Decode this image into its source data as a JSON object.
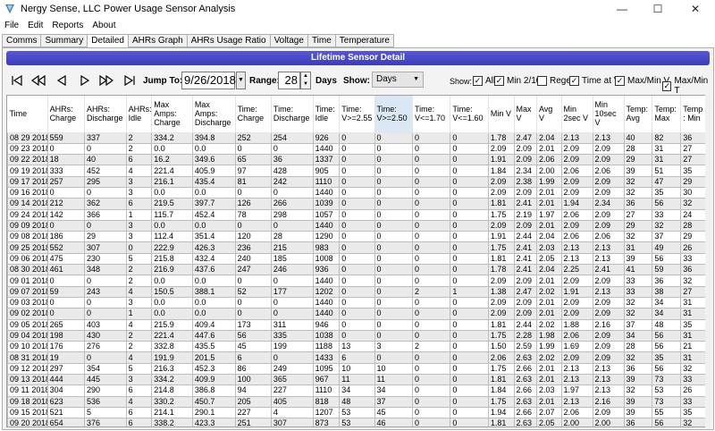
{
  "window": {
    "title": "Nergy Sense, LLC Power Usage Sensor Analysis",
    "minimize": "—",
    "maximize": "☐",
    "close": "✕"
  },
  "menu": [
    "File",
    "Edit",
    "Reports",
    "About"
  ],
  "tabs": [
    {
      "label": "Comms",
      "active": false
    },
    {
      "label": "Summary",
      "active": false
    },
    {
      "label": "Detailed",
      "active": true
    },
    {
      "label": "AHRs Graph",
      "active": false
    },
    {
      "label": "AHRs Usage Ratio",
      "active": false
    },
    {
      "label": "Voltage",
      "active": false
    },
    {
      "label": "Time",
      "active": false
    },
    {
      "label": "Temperature",
      "active": false
    }
  ],
  "banner": "Lifetime Sensor Detail",
  "toolbar": {
    "jump_label": "Jump To:",
    "date_value": "9/26/2018",
    "range_label": "Range:",
    "range_value": "28",
    "days_label": "Days",
    "show_label": "Show:",
    "show_value": "Days",
    "show_checks_label": "Show:",
    "checks": [
      {
        "label": "All",
        "checked": true
      },
      {
        "label": "Min 2/10",
        "checked": true
      },
      {
        "label": "Regen",
        "checked": false
      },
      {
        "label": "Time at V",
        "checked": true
      },
      {
        "label": "Max/Min V",
        "checked": true
      },
      {
        "label": "Max/Min T",
        "checked": true
      }
    ]
  },
  "table": {
    "columns": [
      "Time",
      "AHRs: Charge",
      "AHRs: Discharge",
      "AHRs: Idle",
      "Max Amps: Charge",
      "Max Amps: Discharge",
      "Time: Charge",
      "Time: Discharge",
      "Time: Idle",
      "Time: V>=2.55",
      "Time: V>=2.50",
      "Time: V<=1.70",
      "Time: V<=1.60",
      "Min V",
      "Max V",
      "Avg V",
      "Min 2sec V",
      "Min 10sec V",
      "Temp: Avg",
      "Temp: Max",
      "Temp : Min"
    ],
    "sorted_column": 10,
    "rows": [
      [
        "08 29 2018",
        "559",
        "337",
        "2",
        "334.2",
        "394.8",
        "252",
        "254",
        "926",
        "0",
        "0",
        "0",
        "0",
        "1.78",
        "2.47",
        "2.04",
        "2.13",
        "2.13",
        "40",
        "82",
        "36"
      ],
      [
        "09 23 2018",
        "0",
        "0",
        "2",
        "0.0",
        "0.0",
        "0",
        "0",
        "1440",
        "0",
        "0",
        "0",
        "0",
        "2.09",
        "2.09",
        "2.01",
        "2.09",
        "2.09",
        "28",
        "31",
        "27"
      ],
      [
        "09 22 2018",
        "18",
        "40",
        "6",
        "16.2",
        "349.6",
        "65",
        "36",
        "1337",
        "0",
        "0",
        "0",
        "0",
        "1.91",
        "2.09",
        "2.06",
        "2.09",
        "2.09",
        "29",
        "31",
        "27"
      ],
      [
        "09 19 2018",
        "333",
        "452",
        "4",
        "221.4",
        "405.9",
        "97",
        "428",
        "905",
        "0",
        "0",
        "0",
        "0",
        "1.84",
        "2.34",
        "2.00",
        "2.06",
        "2.06",
        "39",
        "51",
        "35"
      ],
      [
        "09 17 2018",
        "257",
        "295",
        "3",
        "216.1",
        "435.4",
        "81",
        "242",
        "1110",
        "0",
        "0",
        "0",
        "0",
        "2.09",
        "2.38",
        "1.99",
        "2.09",
        "2.09",
        "32",
        "47",
        "29"
      ],
      [
        "09 16 2018",
        "0",
        "0",
        "3",
        "0.0",
        "0.0",
        "0",
        "0",
        "1440",
        "0",
        "0",
        "0",
        "0",
        "2.09",
        "2.09",
        "2.01",
        "2.09",
        "2.09",
        "32",
        "35",
        "30"
      ],
      [
        "09 14 2018",
        "212",
        "362",
        "6",
        "219.5",
        "397.7",
        "126",
        "266",
        "1039",
        "0",
        "0",
        "0",
        "0",
        "1.81",
        "2.41",
        "2.01",
        "1.94",
        "2.34",
        "36",
        "56",
        "32"
      ],
      [
        "09 24 2018",
        "142",
        "366",
        "1",
        "115.7",
        "452.4",
        "78",
        "298",
        "1057",
        "0",
        "0",
        "0",
        "0",
        "1.75",
        "2.19",
        "1.97",
        "2.06",
        "2.09",
        "27",
        "33",
        "24"
      ],
      [
        "09 09 2018",
        "0",
        "0",
        "3",
        "0.0",
        "0.0",
        "0",
        "0",
        "1440",
        "0",
        "0",
        "0",
        "0",
        "2.09",
        "2.09",
        "2.01",
        "2.09",
        "2.09",
        "29",
        "32",
        "28"
      ],
      [
        "09 08 2018",
        "186",
        "29",
        "3",
        "112.4",
        "351.4",
        "120",
        "28",
        "1290",
        "0",
        "0",
        "0",
        "0",
        "1.91",
        "2.44",
        "2.04",
        "2.06",
        "2.06",
        "32",
        "37",
        "29"
      ],
      [
        "09 25 2018",
        "552",
        "307",
        "0",
        "222.9",
        "426.3",
        "236",
        "215",
        "983",
        "0",
        "0",
        "0",
        "0",
        "1.75",
        "2.41",
        "2.03",
        "2.13",
        "2.13",
        "31",
        "49",
        "26"
      ],
      [
        "09 06 2018",
        "475",
        "230",
        "5",
        "215.8",
        "432.4",
        "240",
        "185",
        "1008",
        "0",
        "0",
        "0",
        "0",
        "1.81",
        "2.41",
        "2.05",
        "2.13",
        "2.13",
        "39",
        "56",
        "33"
      ],
      [
        "08 30 2018",
        "461",
        "348",
        "2",
        "216.9",
        "437.6",
        "247",
        "246",
        "936",
        "0",
        "0",
        "0",
        "0",
        "1.78",
        "2.41",
        "2.04",
        "2.25",
        "2.41",
        "41",
        "59",
        "36"
      ],
      [
        "09 01 2018",
        "0",
        "0",
        "2",
        "0.0",
        "0.0",
        "0",
        "0",
        "1440",
        "0",
        "0",
        "0",
        "0",
        "2.09",
        "2.09",
        "2.01",
        "2.09",
        "2.09",
        "33",
        "36",
        "32"
      ],
      [
        "09 07 2018",
        "59",
        "243",
        "4",
        "150.5",
        "388.1",
        "52",
        "177",
        "1202",
        "0",
        "0",
        "2",
        "1",
        "1.38",
        "2.47",
        "2.02",
        "1.91",
        "2.13",
        "33",
        "38",
        "27"
      ],
      [
        "09 03 2018",
        "0",
        "0",
        "3",
        "0.0",
        "0.0",
        "0",
        "0",
        "1440",
        "0",
        "0",
        "0",
        "0",
        "2.09",
        "2.09",
        "2.01",
        "2.09",
        "2.09",
        "32",
        "34",
        "31"
      ],
      [
        "09 02 2018",
        "0",
        "0",
        "1",
        "0.0",
        "0.0",
        "0",
        "0",
        "1440",
        "0",
        "0",
        "0",
        "0",
        "2.09",
        "2.09",
        "2.01",
        "2.09",
        "2.09",
        "32",
        "34",
        "31"
      ],
      [
        "09 05 2018",
        "265",
        "403",
        "4",
        "215.9",
        "409.4",
        "173",
        "311",
        "946",
        "0",
        "0",
        "0",
        "0",
        "1.81",
        "2.44",
        "2.02",
        "1.88",
        "2.16",
        "37",
        "48",
        "35"
      ],
      [
        "09 04 2018",
        "198",
        "430",
        "2",
        "221.4",
        "447.6",
        "56",
        "335",
        "1038",
        "0",
        "0",
        "0",
        "0",
        "1.75",
        "2.28",
        "1.98",
        "2.06",
        "2.09",
        "34",
        "56",
        "31"
      ],
      [
        "09 10 2018",
        "176",
        "276",
        "2",
        "332.8",
        "435.5",
        "45",
        "199",
        "1188",
        "13",
        "3",
        "2",
        "0",
        "1.50",
        "2.59",
        "1.99",
        "1.69",
        "2.09",
        "28",
        "56",
        "21"
      ],
      [
        "08 31 2018",
        "19",
        "0",
        "4",
        "191.9",
        "201.5",
        "6",
        "0",
        "1433",
        "6",
        "0",
        "0",
        "0",
        "2.06",
        "2.63",
        "2.02",
        "2.09",
        "2.09",
        "32",
        "35",
        "31"
      ],
      [
        "09 12 2018",
        "297",
        "354",
        "5",
        "216.3",
        "452.3",
        "86",
        "249",
        "1095",
        "10",
        "10",
        "0",
        "0",
        "1.75",
        "2.66",
        "2.01",
        "2.13",
        "2.13",
        "36",
        "56",
        "32"
      ],
      [
        "09 13 2018",
        "444",
        "445",
        "3",
        "334.2",
        "409.9",
        "100",
        "365",
        "967",
        "11",
        "11",
        "0",
        "0",
        "1.81",
        "2.63",
        "2.01",
        "2.13",
        "2.13",
        "39",
        "73",
        "33"
      ],
      [
        "09 11 2018",
        "304",
        "290",
        "6",
        "214.8",
        "386.8",
        "94",
        "227",
        "1110",
        "34",
        "34",
        "0",
        "0",
        "1.84",
        "2.66",
        "2.03",
        "1.97",
        "2.13",
        "32",
        "53",
        "26"
      ],
      [
        "09 18 2018",
        "623",
        "536",
        "4",
        "330.2",
        "450.7",
        "205",
        "405",
        "818",
        "48",
        "37",
        "0",
        "0",
        "1.75",
        "2.63",
        "2.01",
        "2.13",
        "2.16",
        "39",
        "73",
        "33"
      ],
      [
        "09 15 2018",
        "521",
        "5",
        "6",
        "214.1",
        "290.1",
        "227",
        "4",
        "1207",
        "53",
        "45",
        "0",
        "0",
        "1.94",
        "2.66",
        "2.07",
        "2.06",
        "2.09",
        "39",
        "55",
        "35"
      ],
      [
        "09 20 2018",
        "654",
        "376",
        "6",
        "338.2",
        "423.3",
        "251",
        "307",
        "873",
        "53",
        "46",
        "0",
        "0",
        "1.81",
        "2.63",
        "2.05",
        "2.00",
        "2.00",
        "36",
        "56",
        "32"
      ],
      [
        "09 21 2018",
        "413",
        "268",
        "5",
        "328.8",
        "424.4",
        "125",
        "238",
        "1069",
        "66",
        "59",
        "0",
        "0",
        "1.81",
        "2.63",
        "2.01",
        "2.13",
        "2.13",
        "40",
        "60",
        "36"
      ]
    ]
  }
}
